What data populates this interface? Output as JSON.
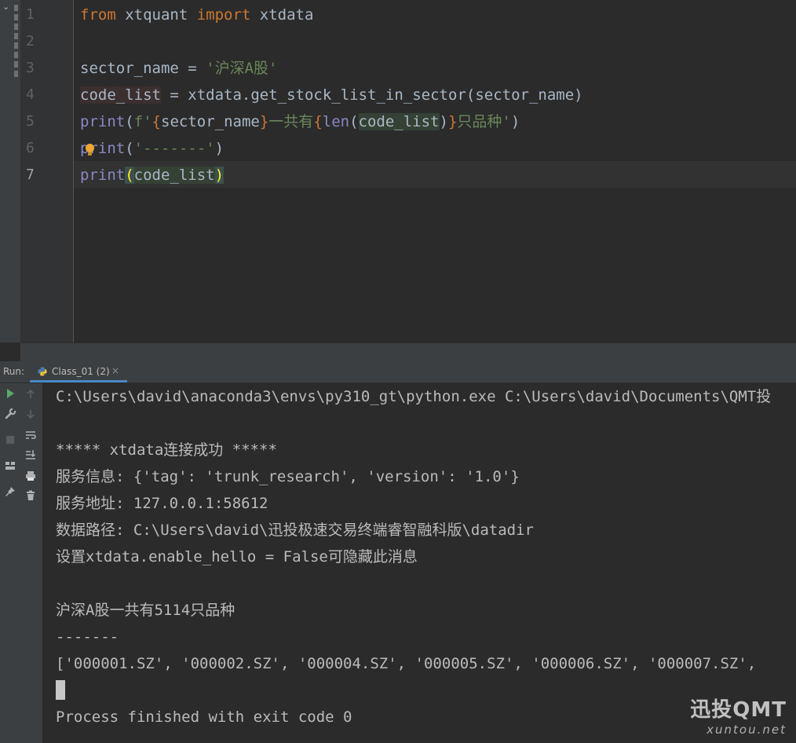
{
  "editor": {
    "line_numbers": [
      "1",
      "2",
      "3",
      "4",
      "5",
      "6",
      "7"
    ],
    "fold_toggle": "⌄",
    "lines": {
      "l1": {
        "kw_from": "from",
        "mod": " xtquant ",
        "kw_import": "import",
        "name": " xtdata"
      },
      "l3": {
        "var": "sector_name",
        "op": " = ",
        "str": "'沪深A股'"
      },
      "l4": {
        "var": "code_list",
        "rest": " = xtdata.get_stock_list_in_sector(sector_name)"
      },
      "l5": {
        "fn": "print",
        "open": "(",
        "fpre": "f'",
        "brace1": "{",
        "ref1": "sector_name",
        "brace2": "}",
        "text1": "一共有",
        "brace3": "{",
        "fn2": "len",
        "open2": "(",
        "ref2": "code_list",
        "close2": ")",
        "brace4": "}",
        "text2": "只品种'",
        "close": ")"
      },
      "l6": {
        "fn": "print",
        "open": "(",
        "str": "'-------'",
        "close": ")"
      },
      "l7": {
        "fn": "print",
        "open": "(",
        "arg": "code_list",
        "close": ")"
      }
    }
  },
  "run": {
    "label": "Run:",
    "tab_label": "Class_01 (2)",
    "tab_close": "×",
    "console_lines": [
      "C:\\Users\\david\\anaconda3\\envs\\py310_gt\\python.exe C:\\Users\\david\\Documents\\QMT投",
      "",
      "***** xtdata连接成功 *****",
      "服务信息: {'tag': 'trunk_research', 'version': '1.0'}",
      "服务地址: 127.0.0.1:58612",
      "数据路径: C:\\Users\\david\\迅投极速交易终端睿智融科版\\datadir",
      "设置xtdata.enable_hello = False可隐藏此消息",
      "",
      "沪深A股一共有5114只品种",
      "-------",
      "['000001.SZ', '000002.SZ', '000004.SZ', '000005.SZ', '000006.SZ', '000007.SZ', ",
      "",
      "Process finished with exit code 0"
    ]
  },
  "watermark": {
    "brand": "迅投QMT",
    "domain": "xuntou.net"
  },
  "icons": {
    "run": "play-icon",
    "wrench": "wrench-icon",
    "stop": "stop-icon",
    "layout": "layout-icon",
    "pin": "pin-icon",
    "up": "arrow-up-icon",
    "down": "arrow-down-icon",
    "wrap": "soft-wrap-icon",
    "scroll": "scroll-to-end-icon",
    "print": "print-icon",
    "trash": "trash-icon",
    "python": "python-icon",
    "bulb": "lightbulb-icon"
  },
  "colors": {
    "keyword": "#cc7832",
    "string": "#6a8759",
    "builtin": "#8888c6",
    "text": "#a9b7c6",
    "console": "#bbbbbb",
    "accent": "#4a88c7"
  }
}
